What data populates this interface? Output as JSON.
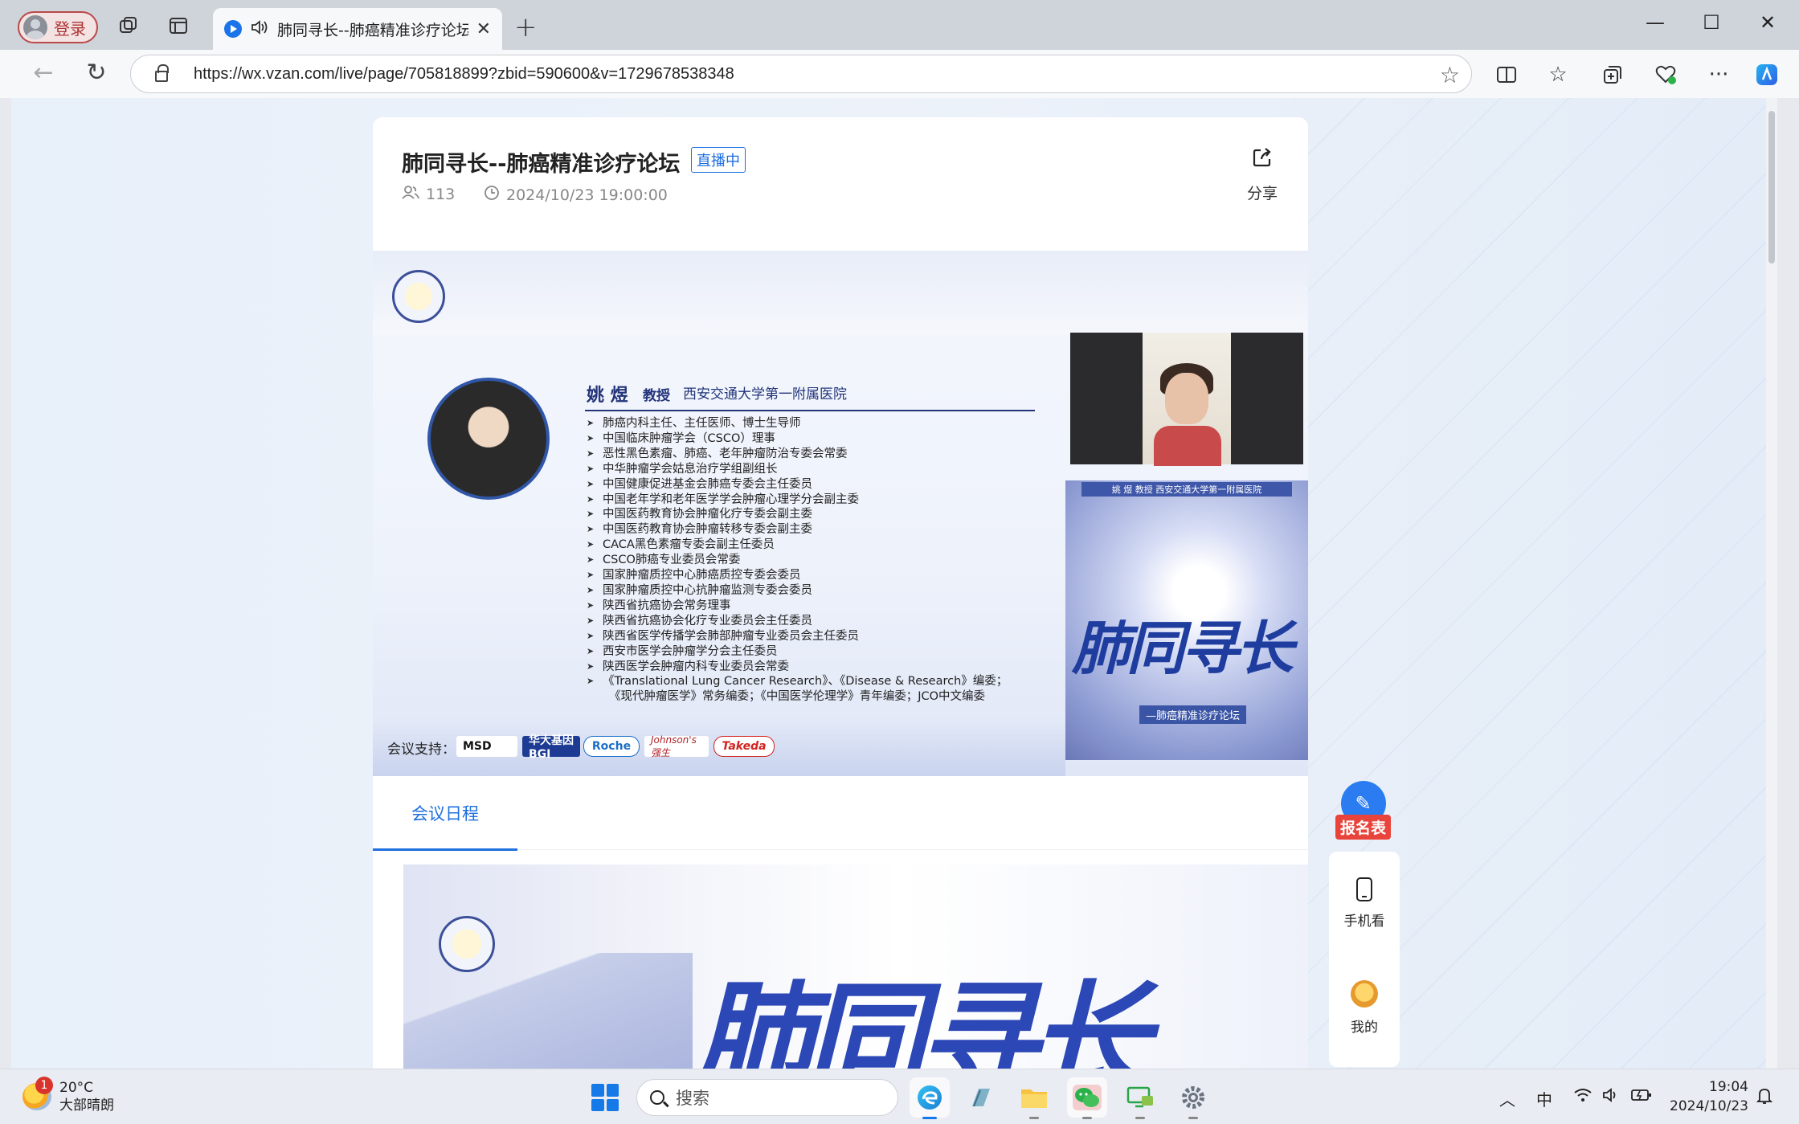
{
  "browser": {
    "login_label": "登录",
    "tab_title": "肺同寻长--肺癌精准诊疗论坛",
    "url": "https://wx.vzan.com/live/page/705818899?zbid=590600&v=1729678538348"
  },
  "page": {
    "title": "肺同寻长--肺癌精准诊疗论坛",
    "live_badge": "直播中",
    "viewers": "113",
    "start_time": "2024/10/23 19:00:00",
    "share_label": "分享",
    "tab_agenda": "会议日程"
  },
  "slide": {
    "speaker_name": "姚  煜",
    "speaker_title": "教授",
    "speaker_org": "西安交通大学第一附属医院",
    "bio": [
      "肺癌内科主任、主任医师、博士生导师",
      "中国临床肿瘤学会（CSCO）理事",
      "恶性黑色素瘤、肺癌、老年肿瘤防治专委会常委",
      "中华肿瘤学会姑息治疗学组副组长",
      "中国健康促进基金会肺癌专委会主任委员",
      "中国老年学和老年医学学会肿瘤心理学分会副主委",
      "中国医药教育协会肿瘤化疗专委会副主委",
      "中国医药教育协会肿瘤转移专委会副主委",
      "CACA黑色素瘤专委会副主任委员",
      "CSCO肺癌专业委员会常委",
      "国家肿瘤质控中心肺癌质控专委会委员",
      "国家肿瘤质控中心抗肿瘤监测专委会委员",
      "陕西省抗癌协会常务理事",
      "陕西省抗癌协会化疗专业委员会主任委员",
      "陕西省医学传播学会肺部肿瘤专业委员会主任委员",
      "西安市医学会肿瘤学分会主任委员",
      "陕西医学会肿瘤内科专业委员会常委",
      "《Translational Lung Cancer Research》、《Disease & Research》编委；",
      "《现代肿瘤医学》常务编委；《中国医学伦理学》青年编委；JCO中文编委"
    ],
    "sponsor_label": "会议支持：",
    "sponsors": [
      "MSD",
      "华大基因 BGI",
      "Roche",
      "Johnson's 强生",
      "Takeda"
    ],
    "poster_band": "姚  煜 教授  西安交通大学第一附属医院",
    "poster_calligraphy": "肺同寻长",
    "poster_subtitle": "—肺癌精准诊疗论坛"
  },
  "agenda_image": {
    "calligraphy": "肺同寻长"
  },
  "side": {
    "signup_label": "报名表",
    "mobile_label": "手机看",
    "me_label": "我的"
  },
  "taskbar": {
    "temperature": "20°C",
    "weather": "大部晴朗",
    "weather_badge": "1",
    "search_placeholder": "搜索",
    "ime": "中",
    "time": "19:04",
    "date": "2024/10/23"
  },
  "colors": {
    "accent": "#1e6fe0",
    "signup_red": "#e8443b",
    "slide_navy": "#23347a"
  }
}
